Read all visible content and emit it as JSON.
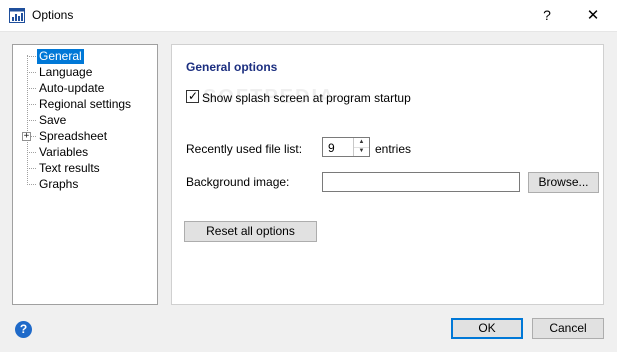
{
  "window": {
    "title": "Options",
    "help_glyph": "?",
    "close_glyph": "✕"
  },
  "tree": {
    "items": [
      {
        "label": "General",
        "selected": true
      },
      {
        "label": "Language"
      },
      {
        "label": "Auto-update"
      },
      {
        "label": "Regional settings"
      },
      {
        "label": "Save"
      },
      {
        "label": "Spreadsheet",
        "expandable": true
      },
      {
        "label": "Variables"
      },
      {
        "label": "Text results"
      },
      {
        "label": "Graphs"
      }
    ],
    "expander_glyph": "+"
  },
  "panel": {
    "heading": "General options",
    "splash_checkbox": {
      "label": "Show splash screen at program startup",
      "checked": true,
      "check_glyph": "✓"
    },
    "recent_files": {
      "label": "Recently used file list:",
      "value": "9",
      "suffix": "entries",
      "up_glyph": "▲",
      "down_glyph": "▼"
    },
    "background_image": {
      "label": "Background image:",
      "value": ""
    },
    "browse_label": "Browse...",
    "reset_label": "Reset all options"
  },
  "footer": {
    "help_glyph": "?",
    "ok_label": "OK",
    "cancel_label": "Cancel"
  },
  "watermark": "SOFTPEDIA",
  "colors": {
    "accent": "#0078d7",
    "heading": "#1c2f80",
    "help_icon": "#1f6ac9"
  }
}
